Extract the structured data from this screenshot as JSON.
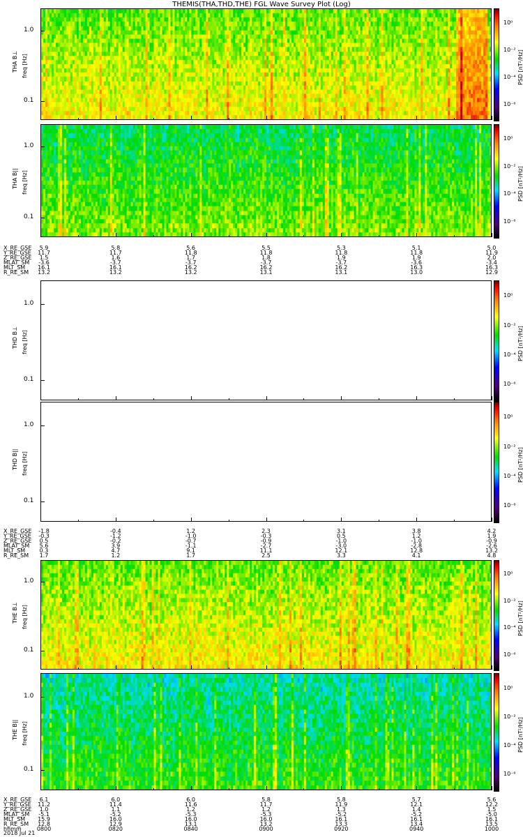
{
  "title": "THEMIS(THA,THD,THE) FGL Wave Survey Plot (Log)",
  "chart_data": {
    "type": "heatmap",
    "title": "THEMIS(THA,THD,THE) FGL Wave Survey Plot (Log)",
    "xlabel": "hhmm",
    "x_ticks": [
      "0800",
      "0820",
      "0840",
      "0900",
      "0920",
      "0940",
      "1000"
    ],
    "date": "2018 Jul 21",
    "ylim": [
      0.05,
      2.0
    ],
    "yscale": "log",
    "colorbar": {
      "label": "PSD [nT²/Hz]",
      "ticks": [
        "10⁰",
        "10⁻²",
        "10⁻⁴",
        "10⁻⁶"
      ],
      "range": [
        1e-07,
        10.0
      ]
    },
    "panels": [
      {
        "probe": "THA B⊥",
        "ylabel": "freq [Hz]",
        "yticks": [
          "1.0",
          "0.1"
        ],
        "has_data": true,
        "dominant": "yellow-orange"
      },
      {
        "probe": "THA B||",
        "ylabel": "freq [Hz]",
        "yticks": [
          "1.0",
          "0.1"
        ],
        "has_data": true,
        "dominant": "green-yellow"
      },
      {
        "probe": "THD B⊥",
        "ylabel": "freq [Hz]",
        "yticks": [
          "1.0",
          "0.1"
        ],
        "has_data": false
      },
      {
        "probe": "THD B||",
        "ylabel": "freq [Hz]",
        "yticks": [
          "1.0",
          "0.1"
        ],
        "has_data": false
      },
      {
        "probe": "THE B⊥",
        "ylabel": "freq [Hz]",
        "yticks": [
          "1.0",
          "0.1"
        ],
        "has_data": true,
        "dominant": "yellow-orange"
      },
      {
        "probe": "THE B||",
        "ylabel": "freq [Hz]",
        "yticks": [
          "1.0",
          "0.1"
        ],
        "has_data": true,
        "dominant": "green-cyan"
      }
    ],
    "ephemeris": [
      {
        "probe": "THA",
        "rows": [
          {
            "name": "X_RE_GSE",
            "values": [
              "5.9",
              "5.8",
              "5.6",
              "5.5",
              "5.3",
              "5.1",
              "5.0"
            ]
          },
          {
            "name": "Y_RE_GSE",
            "values": [
              "11.7",
              "11.7",
              "11.8",
              "11.8",
              "11.8",
              "11.8",
              "11.9"
            ]
          },
          {
            "name": "Z_RE_GSE",
            "values": [
              "1.5",
              "1.6",
              "1.7",
              "1.8",
              "1.9",
              "1.9",
              "2.0"
            ]
          },
          {
            "name": "MLAT_SM",
            "values": [
              "-3.6",
              "-3.7",
              "-3.7",
              "-3.7",
              "-3.7",
              "-3.6",
              "-3.4"
            ]
          },
          {
            "name": "MLT_SM",
            "values": [
              "16.1",
              "16.1",
              "16.2",
              "16.2",
              "16.2",
              "16.3",
              "16.3"
            ]
          },
          {
            "name": "R_RE_SM",
            "values": [
              "13.2",
              "13.2",
              "13.2",
              "13.1",
              "13.1",
              "13.0",
              "12.9"
            ]
          }
        ]
      },
      {
        "probe": "THD",
        "rows": [
          {
            "name": "X_RE_GSE",
            "values": [
              "-1.8",
              "-0.4",
              "1.2",
              "2.3",
              "3.1",
              "3.8",
              "4.2"
            ]
          },
          {
            "name": "Y_RE_GSE",
            "values": [
              "-0.3",
              "-1.2",
              "-1.0",
              "-0.3",
              "0.5",
              "1.2",
              "1.9"
            ]
          },
          {
            "name": "Z_RE_GSE",
            "values": [
              "0.5",
              "-0.2",
              "-0.7",
              "-0.9",
              "-1.0",
              "-1.0",
              "-0.9"
            ]
          },
          {
            "name": "MLAT_SM",
            "values": [
              "5.6",
              "3.9",
              "-1.1",
              "-2.7",
              "-3.0",
              "-2.8",
              "-2.6"
            ]
          },
          {
            "name": "MLT_SM",
            "values": [
              "0.3",
              "4.7",
              "9.1",
              "11.1",
              "12.1",
              "12.8",
              "13.2"
            ]
          },
          {
            "name": "R_RE_SM",
            "values": [
              "1.7",
              "1.2",
              "1.7",
              "2.5",
              "3.3",
              "4.1",
              "4.8"
            ]
          }
        ]
      },
      {
        "probe": "THE",
        "rows": [
          {
            "name": "X_RE_GSE",
            "values": [
              "6.1",
              "6.0",
              "6.0",
              "5.8",
              "5.8",
              "5.7",
              "5.6"
            ]
          },
          {
            "name": "Y_RE_GSE",
            "values": [
              "11.2",
              "11.4",
              "11.6",
              "11.7",
              "11.9",
              "12.1",
              "12.2"
            ]
          },
          {
            "name": "Z_RE_GSE",
            "values": [
              "1.0",
              "1.1",
              "1.2",
              "1.2",
              "1.3",
              "1.4",
              "1.5"
            ]
          },
          {
            "name": "MLAT_SM",
            "values": [
              "-5.1",
              "-5.2",
              "-5.3",
              "-5.3",
              "-5.2",
              "-5.2",
              "-5.0"
            ]
          },
          {
            "name": "MLT_SM",
            "values": [
              "15.9",
              "16.0",
              "16.0",
              "16.0",
              "16.1",
              "16.1",
              "16.1"
            ]
          },
          {
            "name": "R_RE_SM",
            "values": [
              "12.8",
              "12.9",
              "13.1",
              "13.2",
              "13.3",
              "13.4",
              "13.5"
            ]
          },
          {
            "name": "hhmm",
            "values": [
              "0800",
              "0820",
              "0840",
              "0900",
              "0920",
              "0940",
              "1000"
            ]
          }
        ]
      }
    ]
  }
}
